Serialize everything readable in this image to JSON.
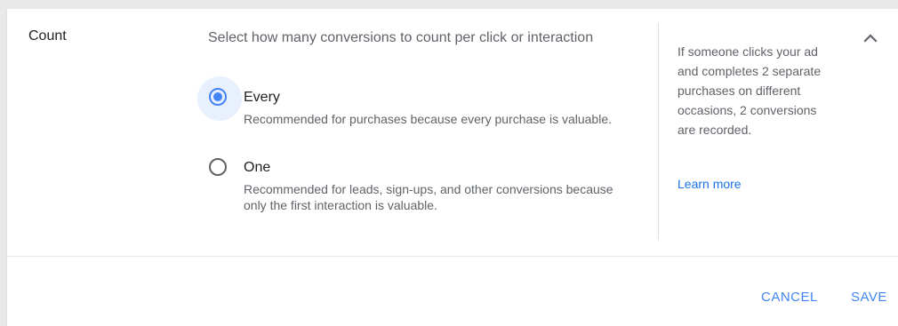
{
  "section": {
    "label": "Count",
    "question": "Select how many conversions to count per click or interaction"
  },
  "options": [
    {
      "title": "Every",
      "description": "Recommended for purchases because every purchase is valuable.",
      "selected": true
    },
    {
      "title": "One",
      "description": "Recommended for leads, sign-ups, and other conversions because only the first interaction is valuable.",
      "selected": false
    }
  ],
  "help": {
    "text": "If someone clicks your ad and completes 2 separate purchases on different occasions, 2 conversions are recorded.",
    "link": "Learn more"
  },
  "actions": {
    "cancel": "CANCEL",
    "save": "SAVE"
  },
  "icons": {
    "collapse": "chevron-up-icon"
  },
  "colors": {
    "accent": "#4285f4",
    "link": "#1a73e8",
    "focus_halo": "#e8f0fe",
    "text_primary": "#212121",
    "text_secondary": "#5f6368"
  }
}
